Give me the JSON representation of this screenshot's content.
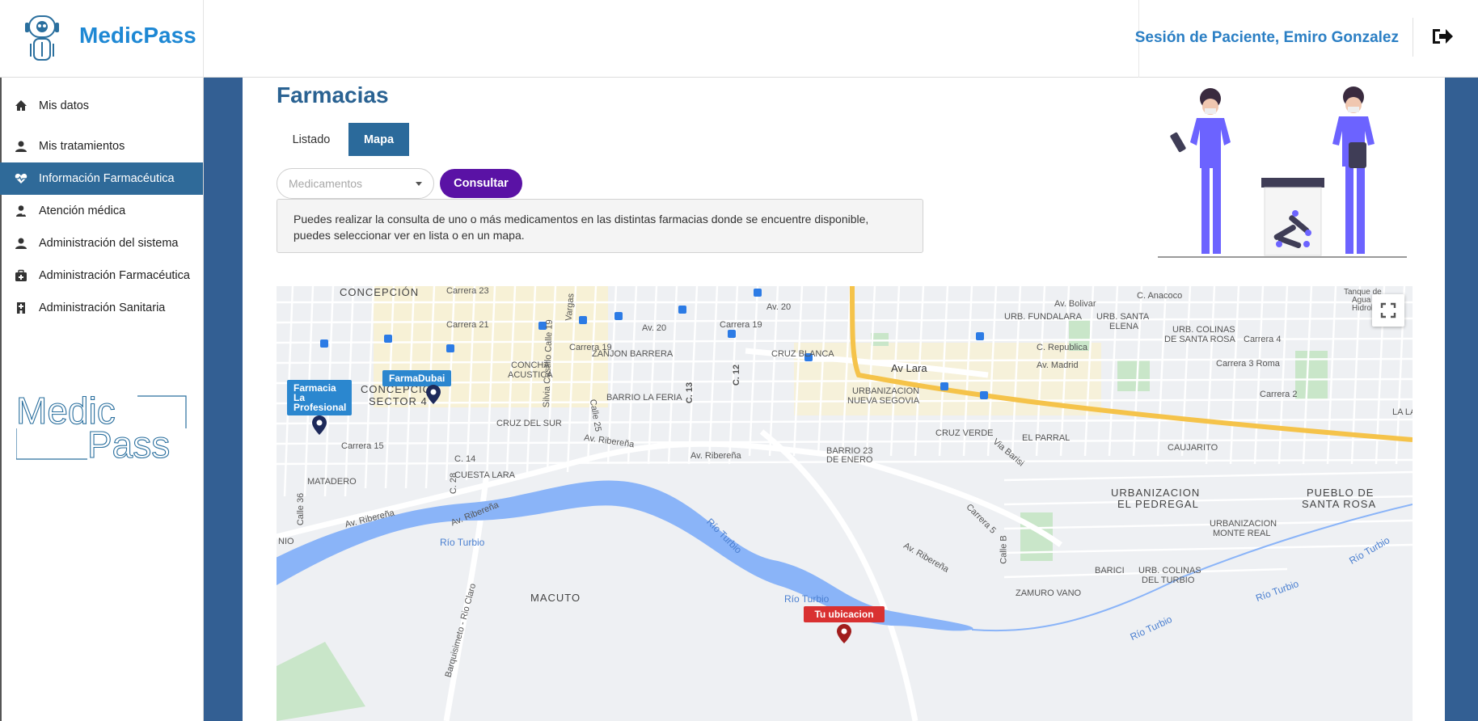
{
  "app": {
    "name": "MedicPass",
    "side_logo_line1": "Medic",
    "side_logo_line2": "Pass"
  },
  "header": {
    "session_text": "Sesión de Paciente, Emiro Gonzalez"
  },
  "sidebar": {
    "items": [
      {
        "label": "Mis datos",
        "icon": "home-icon"
      },
      {
        "label": "Mis tratamientos",
        "icon": "user-icon"
      },
      {
        "label": "Información Farmacéutica",
        "icon": "heartbeat-icon",
        "active": true
      },
      {
        "label": "Atención médica",
        "icon": "doctor-icon"
      },
      {
        "label": "Administración del sistema",
        "icon": "user-icon"
      },
      {
        "label": "Administración Farmacéutica",
        "icon": "medkit-icon"
      },
      {
        "label": "Administración Sanitaria",
        "icon": "hospital-icon"
      }
    ]
  },
  "main": {
    "title": "Farmacias",
    "tabs": [
      {
        "label": "Listado"
      },
      {
        "label": "Mapa",
        "active": true
      }
    ],
    "select_placeholder": "Medicamentos",
    "consult_button": "Consultar",
    "info_text": "Puedes realizar la consulta de uno o más medicamentos en las distintas farmacias donde se encuentre disponible, puedes seleccionar ver en lista o en un mapa."
  },
  "map": {
    "markers": [
      {
        "label": "Farmacia La Profesional"
      },
      {
        "label": "FarmaDubai"
      },
      {
        "label": "Tu ubicacion"
      }
    ],
    "places": {
      "concepcion": "CONCEPCIÓN",
      "concepcion_s4a": "CONCEPCION",
      "concepcion_s4b": "SECTOR 4",
      "concha_a": "CONCHA",
      "concha_b": "ACUSTICA",
      "zanjon": "ZANJON BARRERA",
      "cruz_blanca": "CRUZ BLANCA",
      "urb_fundalara": "URB. FUNDALARA",
      "urb_santa_elena_a": "URB. SANTA",
      "urb_santa_elena_b": "ELENA",
      "urb_colinas_sr_a": "URB. COLINAS",
      "urb_colinas_sr_b": "DE SANTA ROSA",
      "barrio_feria": "BARRIO LA FERIA",
      "urb_nueva_segovia_a": "URBANIZACION",
      "urb_nueva_segovia_b": "NUEVA SEGOVIA",
      "cruz_del_sur": "CRUZ DEL SUR",
      "cruz_verde": "CRUZ VERDE",
      "el_parral": "EL PARRAL",
      "caujarito": "CAUJARITO",
      "barrio23_a": "BARRIO 23",
      "barrio23_b": "DE ENERO",
      "matadero": "MATADERO",
      "cuesta_lara": "CUESTA LARA",
      "urb_pedregal_a": "URBANIZACION",
      "urb_pedregal_b": "EL PEDREGAL",
      "pueblo_sr_a": "PUEBLO DE",
      "pueblo_sr_b": "SANTA ROSA",
      "urb_monte_real_a": "URBANIZACION",
      "urb_monte_real_b": "MONTE REAL",
      "macuto": "MACUTO",
      "barici": "BARICI",
      "urb_colinas_turbio_a": "URB. COLINAS",
      "urb_colinas_turbio_b": "DEL TURBIO",
      "zamuro": "ZAMURO VANO",
      "la_lag": "LA LAG",
      "nio": "NIO"
    },
    "streets": {
      "av_lara": "Av Lara",
      "av_20": "Av. 20",
      "carrera_19": "Carrera 19",
      "av_ribe_1": "Av. Ribereña",
      "av_ribe_2": "Av. Ribereña",
      "av_ribe_3": "Av. Ribereña",
      "av_ribe_4": "Av. Ribereña",
      "av_ribe_5": "Av. Ribereña",
      "rio_turbio_1": "Río Turbio",
      "rio_turbio_2": "Río Turbio",
      "rio_turbio_3": "Río Turbio",
      "rio_turbio_4": "Río Turbio",
      "rio_turbio_5": "Río Turbio",
      "rio_turbio_6": "Río Turbio",
      "carrera_5": "Carrera 5",
      "barq_rio_claro": "Barquisimeto - Rio Claro",
      "av_bolivar": "Av. Bolivar",
      "c_anacoco": "C. Anacoco",
      "c_republica": "C. Republica",
      "av_madrid": "Av. Madrid",
      "carrera_2": "Carrera 2",
      "carrera_4": "Carrera 4",
      "carrera_3_roma": "Carrera 3 Roma",
      "carrera_21": "Carrera 21",
      "carrera_15": "Carrera 15",
      "calle_25": "Calle 25",
      "c_13": "C. 13",
      "c_12": "C. 12",
      "c_14": "C. 14",
      "c_28": "C. 28",
      "c_36": "Calle 36",
      "vargas": "Vargas",
      "carrera_23": "Carrera 23",
      "av_20b": "Av. 20",
      "carrera_19b": "Carrera 19",
      "silvia_castillo": "Silvia Castillo Calle 19",
      "calle_b": "Calle B",
      "via_barisi": "Via Barisi",
      "tanque_a": "Tanque de",
      "tanque_b": "Agua C",
      "tanque_c": "Hidrola"
    }
  }
}
